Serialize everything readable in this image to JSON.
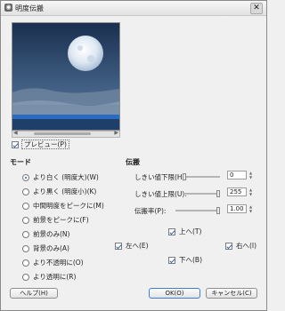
{
  "title": "明度伝搬",
  "preview": {
    "label": "プレビュー(P)",
    "checked": true
  },
  "mode": {
    "title": "モード",
    "options": [
      {
        "label": "より白く (明度大)(W)",
        "selected": true
      },
      {
        "label": "より黒く (明度小)(K)",
        "selected": false
      },
      {
        "label": "中間明度をピークに(M)",
        "selected": false
      },
      {
        "label": "前景をピークに(F)",
        "selected": false
      },
      {
        "label": "前景のみ(N)",
        "selected": false
      },
      {
        "label": "背景のみ(A)",
        "selected": false
      },
      {
        "label": "より不透明に(O)",
        "selected": false
      },
      {
        "label": "より透明に(R)",
        "selected": false
      }
    ]
  },
  "propagation": {
    "title": "伝搬",
    "params": {
      "lower_threshold": {
        "label": "しきい値下限(H):",
        "value": "0",
        "level": 0.0
      },
      "upper_threshold": {
        "label": "しきい値上限(U):",
        "value": "255",
        "level": 1.0
      },
      "rate": {
        "label": "伝搬率(P):",
        "value": "1.00",
        "level": 1.0
      }
    },
    "directions": {
      "up": {
        "label": "上へ(T)",
        "checked": true
      },
      "left": {
        "label": "左へ(E)",
        "checked": true
      },
      "right": {
        "label": "右へ(I)",
        "checked": true
      },
      "down": {
        "label": "下へ(B)",
        "checked": true
      }
    }
  },
  "buttons": {
    "help": "ヘルプ(H)",
    "ok": "OK(O)",
    "cancel": "キャンセル(C)"
  }
}
